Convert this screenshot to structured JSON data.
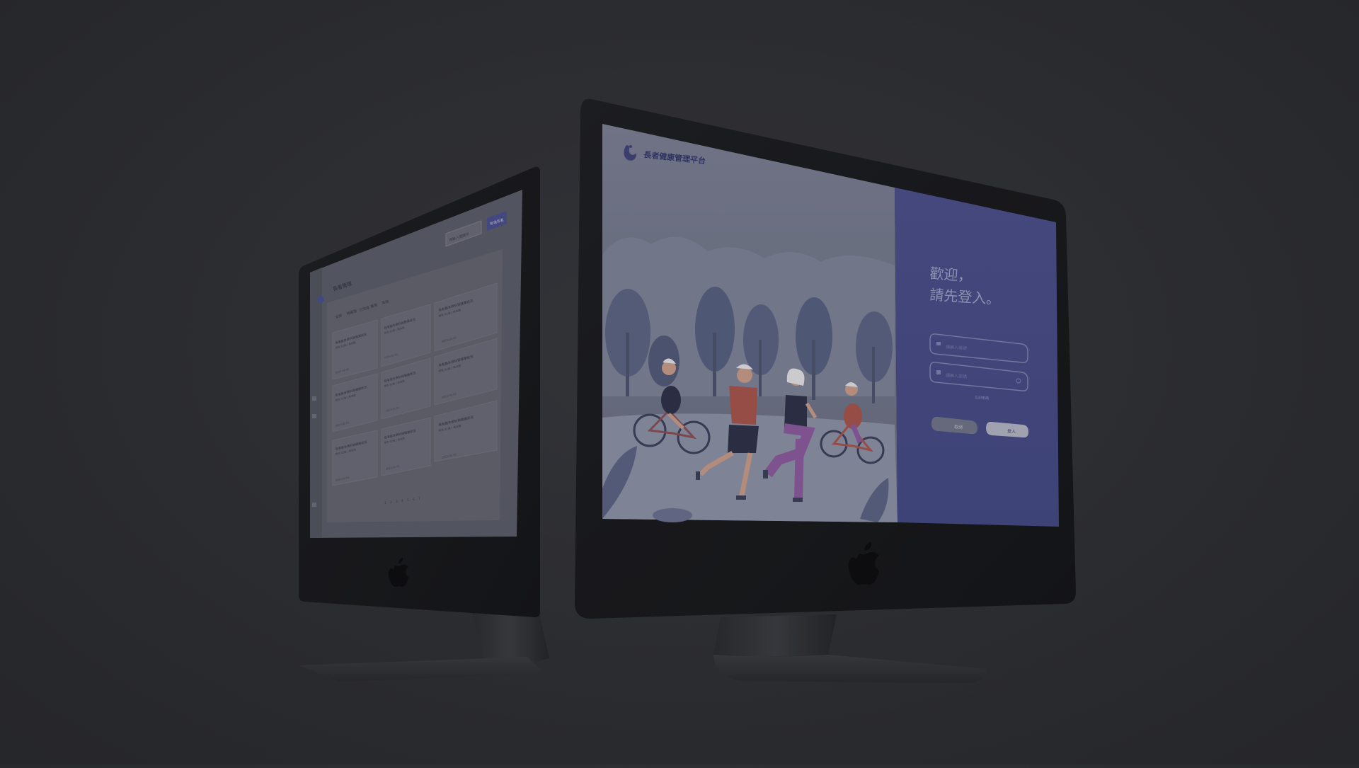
{
  "login": {
    "brand_title": "長者健康管理平台",
    "welcome_line1": "歡迎，",
    "welcome_line2": "請先登入。",
    "account_placeholder": "請輸入帳號",
    "password_placeholder": "請輸入密碼",
    "forgot_link": "忘記密碼",
    "cancel_label": "取消",
    "login_label": "登入"
  },
  "dashboard": {
    "page_title": "長者管理",
    "search_placeholder": "請輸入關鍵字",
    "add_button": "新增長者",
    "filter_tabs": [
      "全部",
      "待處理",
      "已完成",
      "異常",
      "其他"
    ],
    "card_title": "長者基本資料與健康狀況",
    "card_meta": "男性 82歲 | 高血壓",
    "card_footer": "2023-01-01",
    "pagination": [
      "1",
      "2",
      "3",
      "4",
      "5",
      "6",
      "7"
    ]
  },
  "colors": {
    "accent": "#4a4f8e",
    "illustration_bg": "#6c7285",
    "page_bg": "#2e2f32"
  }
}
